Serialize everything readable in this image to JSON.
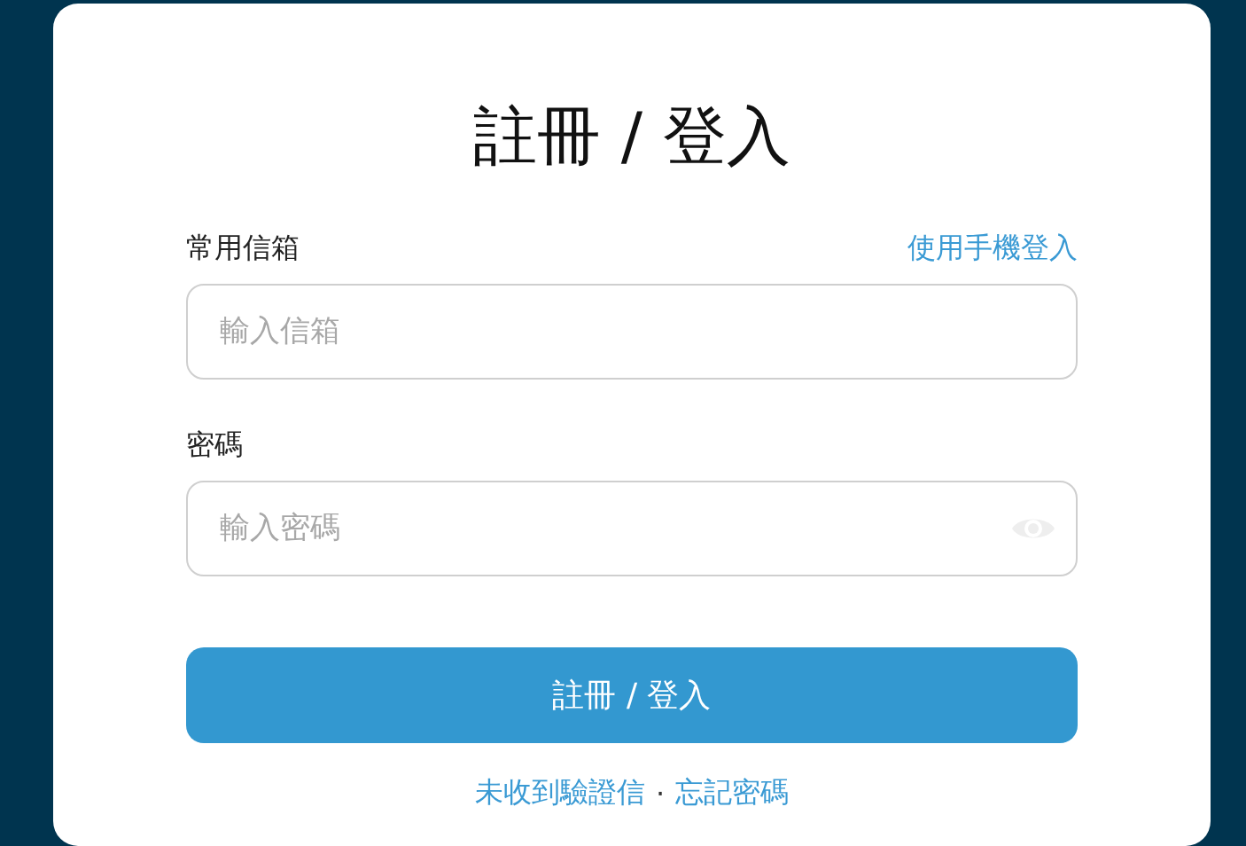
{
  "title": "註冊 / 登入",
  "fields": [
    {
      "label": "常用信箱",
      "placeholder": "輸入信箱",
      "kind": "email",
      "link": "使用手機登入"
    },
    {
      "label": "密碼",
      "placeholder": "輸入密碼",
      "kind": "password"
    }
  ],
  "submit": "註冊 / 登入",
  "footer_links": [
    {
      "text": "未收到驗證信"
    },
    {
      "text": "忘記密碼"
    }
  ],
  "footer_separator": "·"
}
